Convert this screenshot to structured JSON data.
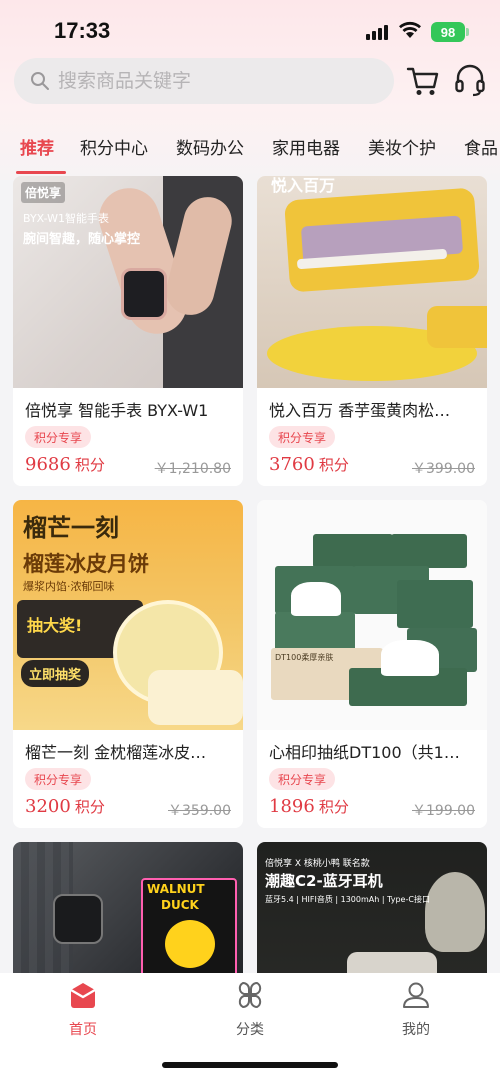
{
  "status_bar": {
    "time": "17:33",
    "battery": "98"
  },
  "search": {
    "placeholder": "搜索商品关键字"
  },
  "tabs": [
    {
      "label": "推荐",
      "active": true
    },
    {
      "label": "积分中心"
    },
    {
      "label": "数码办公"
    },
    {
      "label": "家用电器"
    },
    {
      "label": "美妆个护"
    },
    {
      "label": "食品"
    }
  ],
  "products": [
    {
      "title": "倍悦享 智能手表 BYX-W1",
      "badge": "积分专享",
      "price": "9686",
      "unit": "积分",
      "original": "￥1,210.80",
      "image_text": {
        "brand": "倍悦享",
        "line1": "BYX-W1智能手表",
        "line2": "腕间智趣，随心掌控"
      }
    },
    {
      "title": "悦入百万 香芋蛋黄肉松…",
      "badge": "积分专享",
      "price": "3760",
      "unit": "积分",
      "original": "￥399.00",
      "image_text": {
        "line1": "悦入百万"
      }
    },
    {
      "title": "榴芒一刻 金枕榴莲冰皮…",
      "badge": "积分专享",
      "price": "3200",
      "unit": "积分",
      "original": "￥359.00",
      "image_text": {
        "brand": "榴芒一刻",
        "line1": "榴莲冰皮月饼",
        "line2": "爆浆内馅·浓郁回味",
        "line3": "抽大奖!",
        "line4": "立即抽奖"
      }
    },
    {
      "title": "心相印抽纸DT100（共1…",
      "badge": "积分专享",
      "price": "1896",
      "unit": "积分",
      "original": "￥199.00",
      "image_text": {
        "line1": "DT100柔厚亲肤"
      }
    },
    {
      "title": "",
      "image_text": {
        "line1": "WALNUT",
        "line2": "DUCK"
      }
    },
    {
      "title": "",
      "image_text": {
        "line1": "倍悦享 X 核桃小鸭 联名款",
        "line2": "潮趣C2-蓝牙耳机",
        "line3": "蓝牙5.4 | HIFI音质 | 1300mAh | Type-C接口"
      }
    }
  ],
  "bottom_nav": [
    {
      "label": "首页",
      "icon": "home-icon",
      "active": true
    },
    {
      "label": "分类",
      "icon": "category-icon"
    },
    {
      "label": "我的",
      "icon": "profile-icon"
    }
  ],
  "colors": {
    "accent": "#e8474f",
    "price": "#e03a43",
    "badge_bg": "#fde3e5"
  }
}
